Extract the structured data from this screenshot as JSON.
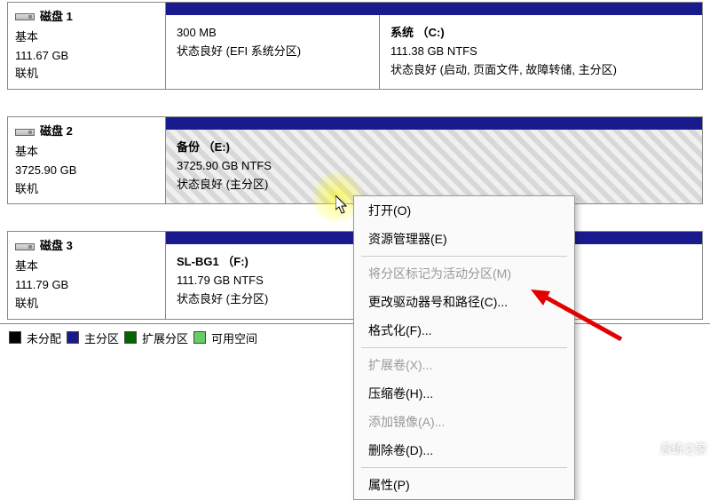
{
  "disks": [
    {
      "title": "磁盘 1",
      "type": "基本",
      "size": "111.67 GB",
      "status": "联机",
      "partitions": [
        {
          "title": "",
          "line1": "300 MB",
          "line2": "状态良好 (EFI 系统分区)"
        },
        {
          "title": "系统 （C:)",
          "line1": "111.38 GB NTFS",
          "line2": "状态良好 (启动, 页面文件, 故障转储, 主分区)"
        }
      ]
    },
    {
      "title": "磁盘 2",
      "type": "基本",
      "size": "3725.90 GB",
      "status": "联机",
      "partitions": [
        {
          "title": "备份 （E:)",
          "line1": "3725.90 GB NTFS",
          "line2": "状态良好 (主分区)"
        }
      ]
    },
    {
      "title": "磁盘 3",
      "type": "基本",
      "size": "111.79 GB",
      "status": "联机",
      "partitions": [
        {
          "title": "SL-BG1 （F:)",
          "line1": "111.79 GB NTFS",
          "line2": "状态良好 (主分区)"
        }
      ]
    }
  ],
  "legend": {
    "unallocated": "未分配",
    "primary": "主分区",
    "extended": "扩展分区",
    "free": "可用空间"
  },
  "menu": {
    "open": "打开(O)",
    "explorer": "资源管理器(E)",
    "mark_active": "将分区标记为活动分区(M)",
    "change_letter": "更改驱动器号和路径(C)...",
    "format": "格式化(F)...",
    "extend": "扩展卷(X)...",
    "shrink": "压缩卷(H)...",
    "mirror": "添加镜像(A)...",
    "delete": "删除卷(D)...",
    "properties": "属性(P)"
  },
  "watermark": "系统之家"
}
